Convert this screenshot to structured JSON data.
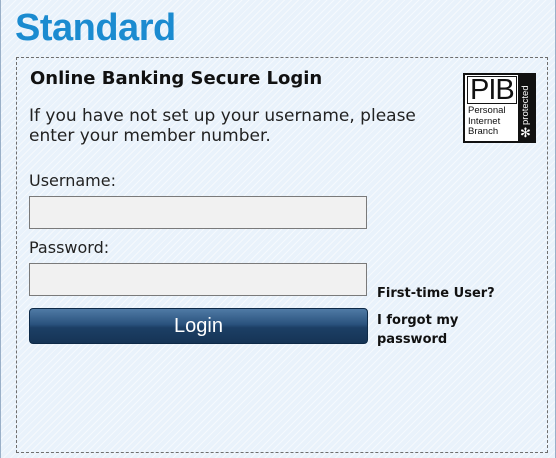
{
  "brand": {
    "title": "Standard"
  },
  "login": {
    "heading": "Online Banking Secure Login",
    "intro": "If you have not set up your username, please enter your member number.",
    "username_label": "Username:",
    "username_value": "",
    "password_label": "Password:",
    "password_value": "",
    "login_button": "Login",
    "first_time_link": "First-time User?",
    "forgot_link": "I forgot my password"
  },
  "pib_logo": {
    "mark": "PIB",
    "description": "Personal Internet Branch",
    "badge": "protected",
    "badge_icon": "asterisk-icon"
  },
  "colors": {
    "brand_blue": "#1b8bd0",
    "panel_background": "#e9f2fb",
    "button_navy": "#1c3f65"
  }
}
